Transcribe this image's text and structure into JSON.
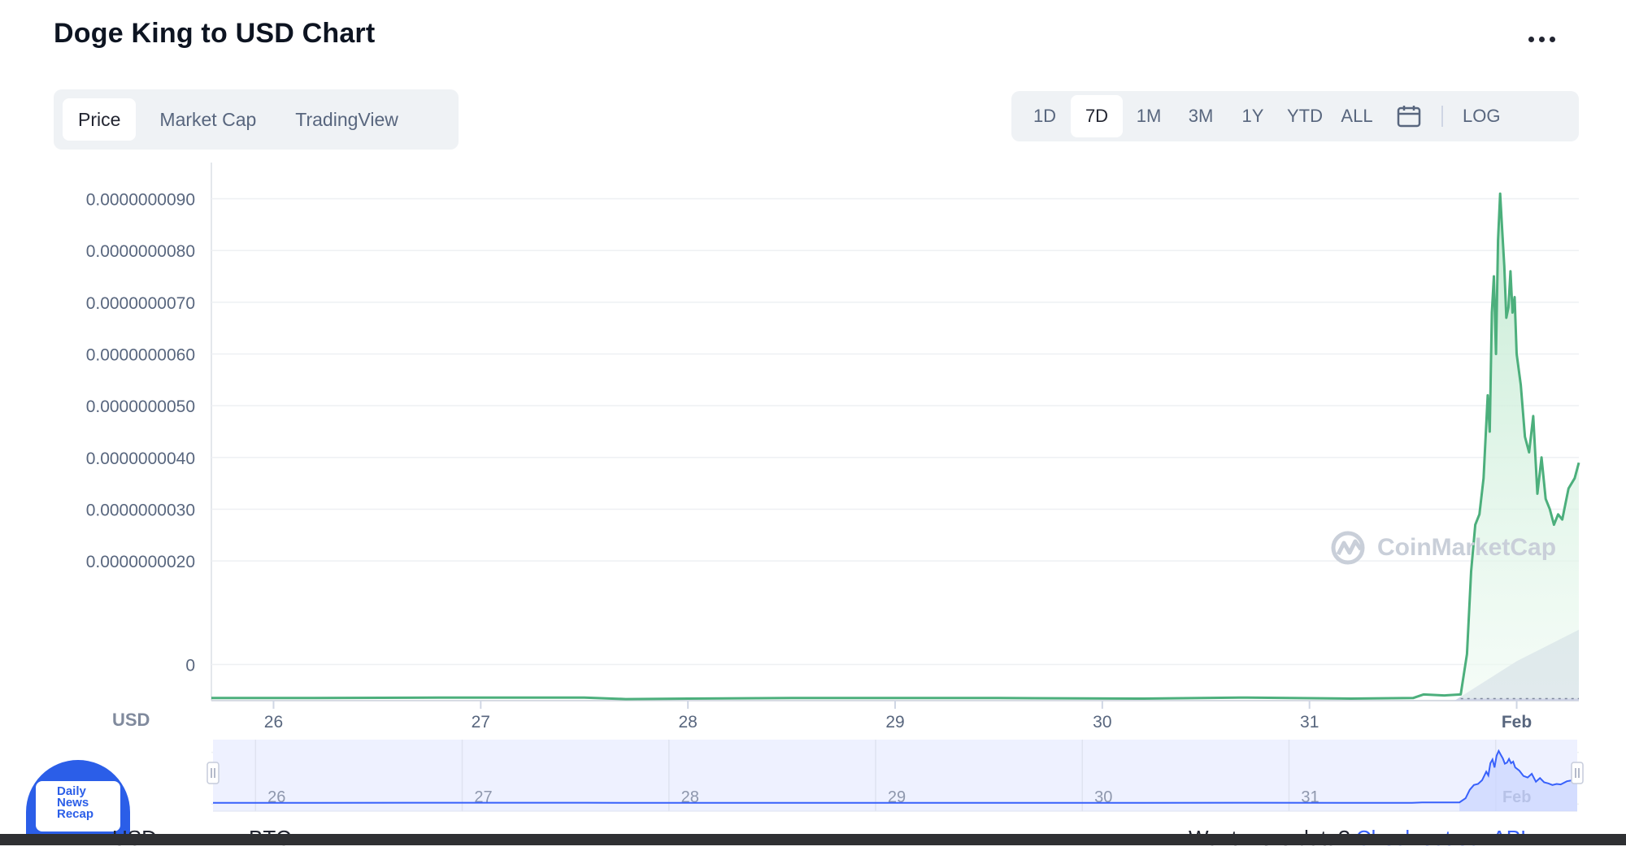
{
  "page": {
    "title": "Doge King to USD Chart"
  },
  "tabs": [
    {
      "label": "Price",
      "active": true
    },
    {
      "label": "Market Cap",
      "active": false
    },
    {
      "label": "TradingView",
      "active": false
    }
  ],
  "ranges": [
    {
      "label": "1D",
      "active": false
    },
    {
      "label": "7D",
      "active": true
    },
    {
      "label": "1M",
      "active": false
    },
    {
      "label": "3M",
      "active": false
    },
    {
      "label": "1Y",
      "active": false
    },
    {
      "label": "YTD",
      "active": false
    },
    {
      "label": "ALL",
      "active": false
    }
  ],
  "log_label": "LOG",
  "icons": {
    "more": "more-dots-icon",
    "calendar": "calendar-icon",
    "watermark": "coinmarketcap-logo-icon"
  },
  "watermark_text": "CoinMarketCap",
  "currency_label": "USD",
  "badge": {
    "line1": "Daily",
    "line2": "News",
    "line3": "Recap"
  },
  "bottom": {
    "usd": "USD",
    "btc": "BTC",
    "prompt": "Want more data?",
    "link": "Check out our API"
  },
  "colors": {
    "price_line": "#4caf7c",
    "area_fill": "#d8f2e3",
    "volume_fill": "#ced3e6",
    "nav_line": "#3861fb",
    "nav_bg": "#eef1ff",
    "accent": "#3861fb"
  },
  "chart_data": {
    "type": "line",
    "ylabel": "USD",
    "y_ticks": [
      "0.0000000090",
      "0.0000000080",
      "0.0000000070",
      "0.0000000060",
      "0.0000000050",
      "0.0000000040",
      "0.0000000030",
      "0.0000000020",
      "0"
    ],
    "ylim": [
      -7e-10,
      9.7e-09
    ],
    "x_ticks": [
      "26",
      "27",
      "28",
      "29",
      "30",
      "31",
      "Feb"
    ],
    "xlim": [
      25.7,
      32.3
    ],
    "grid": true,
    "series": [
      {
        "values": [
          [
            25.7,
            -6.5e-10
          ],
          [
            26.2,
            -6.5e-10
          ],
          [
            26.8,
            -6.4e-10
          ],
          [
            27.5,
            -6.4e-10
          ],
          [
            27.7,
            -6.7e-10
          ],
          [
            28.0,
            -6.6e-10
          ],
          [
            28.5,
            -6.5e-10
          ],
          [
            29.5,
            -6.5e-10
          ],
          [
            30.2,
            -6.6e-10
          ],
          [
            30.7,
            -6.4e-10
          ],
          [
            31.2,
            -6.6e-10
          ],
          [
            31.5,
            -6.5e-10
          ],
          [
            31.55,
            -5.8e-10
          ],
          [
            31.65,
            -6e-10
          ],
          [
            31.73,
            -5.8e-10
          ],
          [
            31.76,
            2e-10
          ],
          [
            31.78,
            1.8e-09
          ],
          [
            31.8,
            2.7e-09
          ],
          [
            31.82,
            2.9e-09
          ],
          [
            31.84,
            3.6e-09
          ],
          [
            31.86,
            5.2e-09
          ],
          [
            31.87,
            4.5e-09
          ],
          [
            31.88,
            6.8e-09
          ],
          [
            31.89,
            7.5e-09
          ],
          [
            31.9,
            6e-09
          ],
          [
            31.91,
            8.2e-09
          ],
          [
            31.92,
            9.1e-09
          ],
          [
            31.93,
            8.4e-09
          ],
          [
            31.94,
            7.7e-09
          ],
          [
            31.95,
            6.7e-09
          ],
          [
            31.96,
            6.9e-09
          ],
          [
            31.97,
            7.6e-09
          ],
          [
            31.98,
            6.8e-09
          ],
          [
            31.99,
            7.1e-09
          ],
          [
            32.0,
            6e-09
          ],
          [
            32.02,
            5.4e-09
          ],
          [
            32.04,
            4.4e-09
          ],
          [
            32.06,
            4.1e-09
          ],
          [
            32.08,
            4.8e-09
          ],
          [
            32.1,
            3.3e-09
          ],
          [
            32.12,
            4e-09
          ],
          [
            32.14,
            3.2e-09
          ],
          [
            32.16,
            3e-09
          ],
          [
            32.18,
            2.7e-09
          ],
          [
            32.2,
            2.9e-09
          ],
          [
            32.22,
            2.8e-09
          ],
          [
            32.25,
            3.4e-09
          ],
          [
            32.28,
            3.6e-09
          ],
          [
            32.3,
            3.9e-09
          ]
        ]
      }
    ],
    "volume": [
      [
        31.7,
        0.0
      ],
      [
        31.85,
        0.25
      ],
      [
        32.0,
        0.5
      ],
      [
        32.15,
        0.7
      ],
      [
        32.3,
        0.9
      ]
    ],
    "navigator_ticks": [
      "26",
      "27",
      "28",
      "29",
      "30",
      "31",
      "Feb"
    ]
  }
}
